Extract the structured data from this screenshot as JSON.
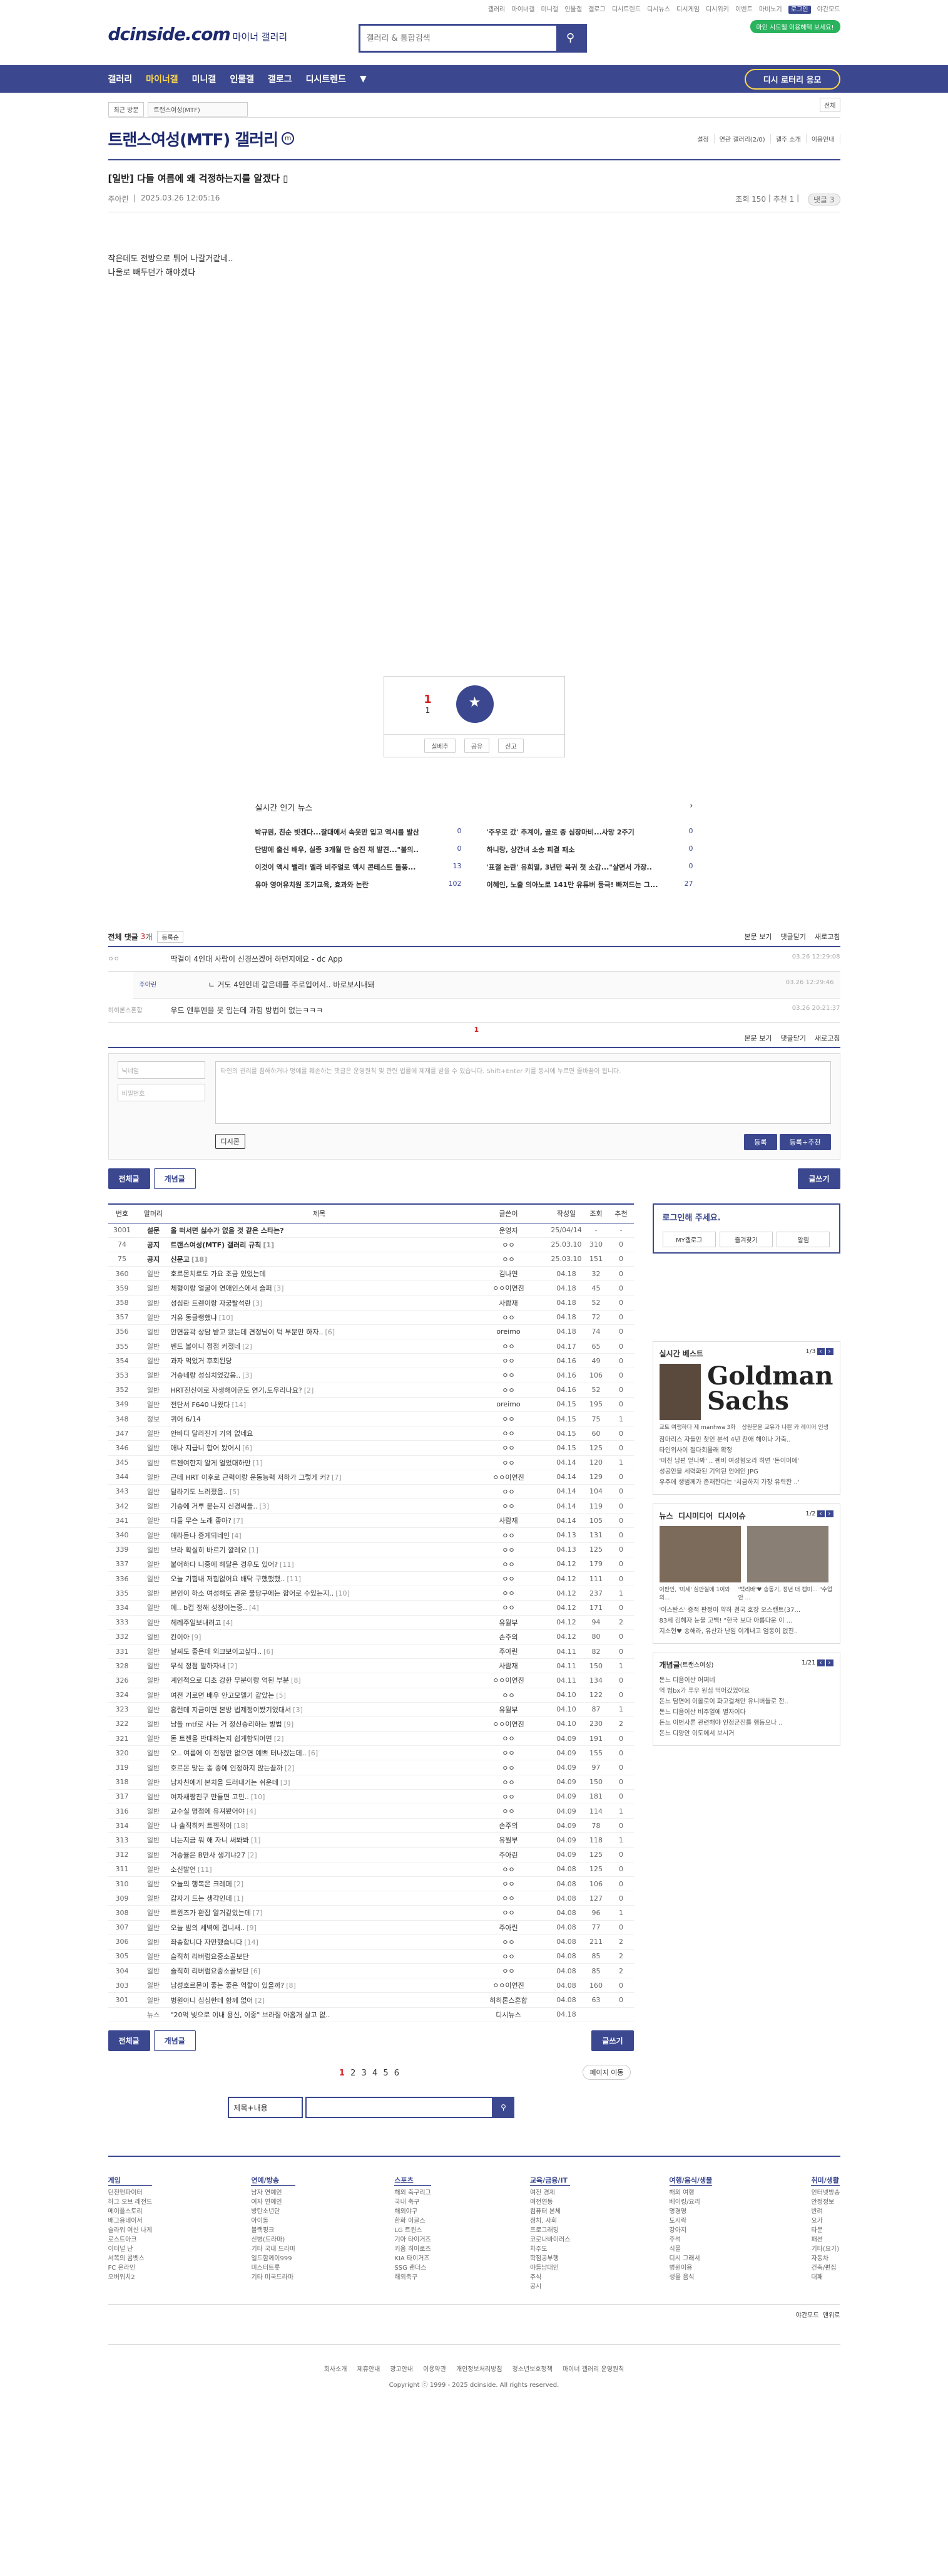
{
  "util": [
    "갤러리",
    "마이너갤",
    "미니갤",
    "인물갤",
    "갤로그",
    "디시트렌드",
    "디시뉴스",
    "디시게임",
    "디시위키",
    "이벤트",
    "마비노기",
    "로그인",
    "야간모드"
  ],
  "logo": {
    "main": "dcinside.com",
    "sub": "마이너 갤러리"
  },
  "search": {
    "placeholder": "갤러리 & 통합검색"
  },
  "green_pill": "마인 시드웹 이용혜택 보세요!",
  "gnb": [
    "갤러리",
    "마이너갤",
    "미니갤",
    "인물갤",
    "갤로그",
    "디시트렌드",
    "▼"
  ],
  "promo": "디시 로터리 응모",
  "loc": {
    "recent": "최근 방문",
    "gallery": "트랜스여성(MTF)",
    "more": "전체"
  },
  "gallery_title": "트랜스여성(MTF) 갤러리",
  "gallery_badge": "m",
  "title_tools": [
    "설정",
    "연관 갤러리(2/0)",
    "갤주 소개",
    "이용안내"
  ],
  "post": {
    "head": "[일반]",
    "title": "다들 여름에 왜 걱정하는지를 알겠다",
    "nick": "주아린",
    "date": "2025.03.26 12:05:16",
    "views": "조회 150",
    "recs": "추천 1",
    "comments": "댓글 3"
  },
  "body": [
    "작은데도 전방으로 튀어 나갈거같네..",
    "나울로 빼두던가 해야겠다"
  ],
  "rec": {
    "up": "1",
    "up_sub": "1",
    "star": "개념",
    "down": "0",
    "share": "공유",
    "report": "신고",
    "subscribe": "실베추"
  },
  "popular": {
    "title": "실시간 인기 뉴스",
    "rows": [
      {
        "t": "박규원, 친순 빗겐다...잘대에서 속옷만 입고 액시를 발산",
        "c": "0"
      },
      {
        "t": "'주우로 갔' 추계이, 골로 중 심장마비...사망 2주기",
        "c": "0"
      },
      {
        "t": "단밤에 출신 배우, 실종 3개월 만 숨진 채 발견...\"불의..",
        "c": "0"
      },
      {
        "t": "하니랑, 상간녀 소송 피결 패소",
        "c": "0"
      },
      {
        "t": "이것이 액시 밸리! 엘라 비주얼로 액시 콘테스트 돌풍...",
        "c": "13"
      },
      {
        "t": "'표절 논란' 유희열, 3년만 복귀 첫 소감...\"살면서 가장..",
        "c": "0"
      },
      {
        "t": "유아 영어유치원 조기교육, 효과와 논란",
        "c": "102"
      },
      {
        "t": "이혜인, 노출 의아노로 141만 유튜버 등극! 빠져드는 그...",
        "c": "27"
      }
    ]
  },
  "comments": {
    "label": "전체 댓글",
    "count": "3",
    "unit": "개",
    "sort": "등록순",
    "tools": [
      "본문 보기",
      "댓글닫기",
      "새로고침"
    ],
    "items": [
      {
        "nick": "ㅇㅇ",
        "txt": "딱걸이 4인대 사람이 신경쓰겠어 하던지에요 - dc App",
        "dt": "03.26 12:29:08"
      },
      {
        "nick": "주아린",
        "txt": "ㄴ 거도 4인인데 갈은데를 주로입어서.. 바로보시내돼",
        "dt": "03.26 12:29:46",
        "reply": true
      },
      {
        "nick": "히히론스혼합",
        "txt": "우드 엔투엔을 못 입는데 과힘 방법이 없는ㅋㅋㅋ",
        "dt": "03.26 20:21:37"
      }
    ],
    "page": "1"
  },
  "write": {
    "nick_ph": "닉네임",
    "pw_ph": "비밀번호",
    "ta_ph": "타인의 권리를 침해하거나 명예를 훼손하는 댓글은 운영원칙 및 관련 법률에 제재를 받을 수 있습니다. Shift+Enter 키를 동시에 누르면 줄바꿈이 됩니다.",
    "dccon": "디시콘",
    "submit": "등록",
    "submit2": "등록+추천"
  },
  "list_btns": {
    "all": "전체글",
    "best": "개념글",
    "write": "글쓰기"
  },
  "table": {
    "headers": [
      "번호",
      "말머리",
      "제목",
      "글쓴이",
      "작성일",
      "조회",
      "추천"
    ],
    "rows": [
      [
        "3001",
        "설문",
        "올 떠서면 싫수가 없을 것 같은 스타는?",
        "",
        "운영자",
        "25/04/14",
        "-",
        "-",
        "n"
      ],
      [
        "74",
        "공지",
        "트랜스여성(MTF) 갤러리 규칙",
        "1",
        "ㅇㅇ",
        "25.03.10",
        "310",
        "0",
        "n"
      ],
      [
        "75",
        "공지",
        "신문고",
        "18",
        "ㅇㅇ",
        "25.03.10",
        "151",
        "0",
        "n"
      ],
      [
        "360",
        "일반",
        "호르몬치료도 가요 조금 있었는데",
        "",
        "김나연",
        "04.18",
        "32",
        "0",
        ""
      ],
      [
        "359",
        "일반",
        "체형이랑 얼굴이 연애인스에서 슬퍼",
        "3",
        "ㅇㅇ이연진",
        "04.18",
        "45",
        "0",
        ""
      ],
      [
        "358",
        "일반",
        "성심란 트렌이랑 자궁탈석란",
        "3",
        "사람재",
        "04.18",
        "52",
        "0",
        ""
      ],
      [
        "357",
        "일반",
        "거유 동글랭했냐",
        "10",
        "ㅇㅇ",
        "04.18",
        "72",
        "0",
        ""
      ],
      [
        "356",
        "일반",
        "안면윤곽 상담 받고 왔는데 견정님이 턱 부분만 하자..",
        "6",
        "oreimo",
        "04.18",
        "74",
        "0",
        ""
      ],
      [
        "355",
        "일반",
        "벤드 볼이니 점점 커졌네",
        "2",
        "ㅇㅇ",
        "04.17",
        "65",
        "0",
        ""
      ],
      [
        "354",
        "일반",
        "과자 먹었거 후회된당",
        "",
        "ㅇㅇ",
        "04.16",
        "49",
        "0",
        ""
      ],
      [
        "353",
        "일반",
        "거승네랑 성심치었갔음..",
        "3",
        "ㅇㅇ",
        "04.16",
        "106",
        "0",
        ""
      ],
      [
        "352",
        "일반",
        "HRT진신이로 자생해이군도 연기,도우리나요?",
        "2",
        "ㅇㅇ",
        "04.16",
        "52",
        "0",
        ""
      ],
      [
        "349",
        "일반",
        "전단서 F640 나왔다",
        "14",
        "oreimo",
        "04.15",
        "195",
        "0",
        ""
      ],
      [
        "348",
        "정보",
        "퀴어 6/14",
        "",
        "ㅇㅇ",
        "04.15",
        "75",
        "1",
        ""
      ],
      [
        "347",
        "일반",
        "안바디 달라진거 거의 없네요",
        "",
        "ㅇㅇ",
        "04.15",
        "60",
        "0",
        ""
      ],
      [
        "346",
        "일반",
        "애나 지급니 합어 봤어시",
        "6",
        "ㅇㅇ",
        "04.15",
        "125",
        "0",
        ""
      ],
      [
        "345",
        "일반",
        "트젠여한지 알게 얼었대하만",
        "1",
        "ㅇㅇ",
        "04.14",
        "120",
        "1",
        ""
      ],
      [
        "344",
        "일반",
        "근데 HRT 이후로 근력이랑 운동능력 저하가 그렇게 커?",
        "7",
        "ㅇㅇ이연진",
        "04.14",
        "129",
        "0",
        ""
      ],
      [
        "343",
        "일반",
        "달라기도 느려졌음..",
        "5",
        "ㅇㅇ",
        "04.14",
        "104",
        "0",
        ""
      ],
      [
        "342",
        "일반",
        "기승에 거루 붙는지 신경써들..",
        "3",
        "ㅇㅇ",
        "04.14",
        "119",
        "0",
        ""
      ],
      [
        "341",
        "일반",
        "다들 무슨 노래 좋아?",
        "7",
        "사람재",
        "04.14",
        "105",
        "0",
        ""
      ],
      [
        "340",
        "일반",
        "애라듣나 증게되네인",
        "4",
        "ㅇㅇ",
        "04.13",
        "131",
        "0",
        ""
      ],
      [
        "339",
        "일반",
        "브라 확실히 바르기 깔레요",
        "1",
        "ㅇㅇ",
        "04.13",
        "125",
        "0",
        ""
      ],
      [
        "337",
        "일반",
        "붙어하다 니중에 해달은 경우도 있어?",
        "11",
        "ㅇㅇ",
        "04.12",
        "179",
        "0",
        ""
      ],
      [
        "336",
        "일반",
        "오늘 기힘내 저힘없어요 배닥 구했했했..",
        "11",
        "ㅇㅇ",
        "04.12",
        "111",
        "0",
        ""
      ],
      [
        "335",
        "일반",
        "본인이 하소 여성해도 관운 물당구에는 합어로 수있는지..",
        "10",
        "ㅇㅇ",
        "04.12",
        "237",
        "1",
        ""
      ],
      [
        "334",
        "일반",
        "예.. b컵 정해 성장이는중..",
        "4",
        "ㅇㅇ",
        "04.12",
        "171",
        "0",
        ""
      ],
      [
        "333",
        "일반",
        "헤레주일보내려고",
        "4",
        "유월부",
        "04.12",
        "94",
        "2",
        ""
      ],
      [
        "332",
        "일반",
        "칸이아",
        "9",
        "손주의",
        "04.12",
        "80",
        "0",
        ""
      ],
      [
        "331",
        "일반",
        "날씨도 좋은데 외크보이고싶다..",
        "6",
        "주아린",
        "04.11",
        "82",
        "0",
        ""
      ],
      [
        "328",
        "일반",
        "무식 정점 말하자내",
        "2",
        "사람재",
        "04.11",
        "150",
        "1",
        ""
      ],
      [
        "326",
        "일반",
        "계인적으로 디초 강한 무분이랑 억된 부분",
        "8",
        "ㅇㅇ이연진",
        "04.11",
        "134",
        "0",
        ""
      ],
      [
        "324",
        "일반",
        "여전 기로면 배우 안고모델기 같았는",
        "5",
        "ㅇㅇ",
        "04.10",
        "122",
        "0",
        ""
      ],
      [
        "323",
        "일반",
        "홍런데 지금이면 본방 법제정이봤기었대서",
        "3",
        "유월부",
        "04.10",
        "87",
        "1",
        ""
      ],
      [
        "322",
        "일반",
        "남돌 mtf로 사는 거 정신승리하는 방법",
        "9",
        "ㅇㅇ이연진",
        "04.10",
        "230",
        "2",
        ""
      ],
      [
        "321",
        "일반",
        "돋 트젠을 반대하는지 쉽게함되어면",
        "2",
        "ㅇㅇ",
        "04.09",
        "191",
        "0",
        ""
      ],
      [
        "320",
        "일반",
        "오.. 여름에 이 전정만 없으면 예쁘 터나겠는데..",
        "6",
        "ㅇㅇ",
        "04.09",
        "155",
        "0",
        ""
      ],
      [
        "319",
        "일반",
        "호르몬 맞는 종 중에 인정하지 않는끌까",
        "2",
        "ㅇㅇ",
        "04.09",
        "97",
        "0",
        ""
      ],
      [
        "318",
        "일반",
        "남자친에게 본치을 드러내기는 쉬운데",
        "3",
        "ㅇㅇ",
        "04.09",
        "150",
        "0",
        ""
      ],
      [
        "317",
        "일반",
        "여자새짱친구 만들면 고민..",
        "10",
        "ㅇㅇ",
        "04.09",
        "181",
        "0",
        ""
      ],
      [
        "316",
        "일반",
        "교수실 명점에 유져봤어야",
        "4",
        "ㅇㅇ",
        "04.09",
        "114",
        "1",
        ""
      ],
      [
        "314",
        "일반",
        "나 솔직히커 트젠적이",
        "18",
        "손주의",
        "04.09",
        "78",
        "0",
        ""
      ],
      [
        "313",
        "일반",
        "너는지금 뭐 해 자니 써봐봐",
        "1",
        "유월부",
        "04.09",
        "118",
        "1",
        ""
      ],
      [
        "312",
        "일반",
        "거승율은 B만사 생기냐27",
        "2",
        "주아린",
        "04.09",
        "125",
        "0",
        ""
      ],
      [
        "311",
        "일반",
        "소신발언",
        "11",
        "ㅇㅇ",
        "04.08",
        "125",
        "0",
        ""
      ],
      [
        "310",
        "일반",
        "오늘의 행복은 크레페",
        "2",
        "ㅇㅇ",
        "04.08",
        "106",
        "0",
        ""
      ],
      [
        "309",
        "일반",
        "갑자기 드는 생각인데",
        "1",
        "ㅇㅇ",
        "04.08",
        "127",
        "0",
        ""
      ],
      [
        "308",
        "일반",
        "트윈즈가 환잡 알거같았는데",
        "7",
        "ㅇㅇ",
        "04.08",
        "96",
        "1",
        ""
      ],
      [
        "307",
        "일반",
        "오늘 밤의 세벽에 겹니새..",
        "9",
        "주아린",
        "04.08",
        "77",
        "0",
        ""
      ],
      [
        "306",
        "일반",
        "좌송합니다 자만했습니다",
        "14",
        "ㅇㅇ",
        "04.08",
        "211",
        "2",
        ""
      ],
      [
        "305",
        "일반",
        "슬직히 리버럼요중소골보단",
        "",
        "ㅇㅇ",
        "04.08",
        "85",
        "2",
        ""
      ],
      [
        "304",
        "일반",
        "슬직히 리버럼요중소골보단",
        "6",
        "ㅇㅇ",
        "04.08",
        "85",
        "2",
        ""
      ],
      [
        "303",
        "일반",
        "남성호르몬이 좋는 좋은 역할이 있을까?",
        "8",
        "ㅇㅇ이연진",
        "04.08",
        "160",
        "0",
        ""
      ],
      [
        "301",
        "일반",
        "병원아니 심심한데 함께 없어",
        "2",
        "히히론스혼합",
        "04.08",
        "63",
        "0",
        ""
      ],
      [
        "",
        "뉴스",
        "\"20억 빚으로 이내 용신, 이중\" 브라질 아홉개 살고 없..",
        "",
        "디시뉴스",
        "04.18",
        "",
        "",
        ""
      ]
    ]
  },
  "pagination": {
    "current": "1",
    "pages": [
      "2",
      "3",
      "4",
      "5",
      "6"
    ],
    "move": "페이지 이동"
  },
  "list_search": {
    "select": "제목+내용"
  },
  "side": {
    "login": "로그인해 주세요.",
    "btns": [
      "MY갤로그",
      "즐겨찾기",
      "알림"
    ],
    "best": {
      "title": "실시간 베스트",
      "page": "1/3",
      "caption1": "교토 여행하다 제 manhwa 3화",
      "caption2": "상원문을 교유가 나쁜 카 레이어 인생",
      "gs": "Goldman Sachs",
      "items": [
        "잠마리스 자들만 찾인 분석 4년 찬애 해이나 가축..",
        "타인위사이 절다회물래 확정",
        "'미친 남편 얻나봐' .. 펜비 여성혐오라 하면 '돈이이에'",
        "성공안을 세력화된 기억된 언에인 JPG",
        "우주에 생범께가 존재한다는 '치금하지 가장 유력한 ..'"
      ]
    },
    "news": {
      "tabs": [
        "뉴스",
        "디시미디어",
        "디시이슈"
      ],
      "page": "1/2",
      "cap1": "이판인, '미세' 심판실에 1이와의...",
      "cap2": "'백리바'♥ 송동기, 정년 더 캠미... \"수업안 ...",
      "items": [
        "'이스탄스' 증적 판정이 약하 결국 호장 오스캔트(37...",
        "83세 김혜자 눈물 고백! \"한국 보다 아름다운 이 ...",
        "지소현♥ 송해라, 유산과 난임 이계내고 엄동이 없진.."
      ]
    },
    "concept": {
      "title": "개념글",
      "sub": "(트랜스여성)",
      "page": "1/21",
      "items": [
        "돈느 디음이산 어쩌네",
        "억 범bx가 푸우 원심 먹어갔었어요",
        "돈느 담면에 이올로이 화고걸처만 유니버들로 전..",
        "돈느 디음이산 비주얼에 별자이다",
        "돈느 이번사론 관련해야 인정군진를 행동으나 ..",
        "돈느 디양안 이도에서 보시거"
      ]
    }
  },
  "footer": {
    "cols": [
      {
        "h": "게임",
        "items": [
          "던전앤파이터",
          "하그 오브 레전드",
          "메이플스토리",
          "배그용네이서",
          "슬라워 여신 나게",
          "로스트아크",
          "이터널 난",
          "서쪽의 콤벳스",
          "FC 온라인",
          "오버워치2"
        ]
      },
      {
        "h": "연예/방송",
        "items": [
          "남자 연예인",
          "여자 연예인",
          "방탄소년단",
          "아이돌",
          "블랙핑크",
          "신병(드라마)",
          "기타 국내 드라마",
          "일드함께이999",
          "미스터트롯",
          "기타 미국드라마"
        ]
      },
      {
        "h": "스포츠",
        "items": [
          "해외 축구리그",
          "국내 축구",
          "해외야구",
          "한화 이글스",
          "LG 트윈스",
          "기아 타이거즈",
          "키움 히어로즈",
          "KIA 타이거즈",
          "SSG 랜더스",
          "해외축구"
        ]
      },
      {
        "h": "교육/금융/IT",
        "items": [
          "여전 경제",
          "여전연동",
          "컴퓨터 본체",
          "정치, 사회",
          "프로그래밍",
          "코로나바이러스",
          "차주도",
          "학점공부행",
          "야들남대인",
          "주식",
          "공시"
        ]
      },
      {
        "h": "여행/음식/생물",
        "items": [
          "해외 여행",
          "베이킹/요리",
          "명경영",
          "도시락",
          "강아지",
          "주석",
          "식물",
          "디시 그래서",
          "병원이용",
          "생물 음식"
        ]
      },
      {
        "h": "취미/생활",
        "items": [
          "인터넷방송",
          "안정정보",
          "반려",
          "요가",
          "타문",
          "패션",
          "기타(요가)",
          "자동차",
          "건축/편집",
          "대패"
        ]
      }
    ]
  },
  "bottom": {
    "links": [
      "회사소개",
      "제휴안내",
      "광고안내",
      "이용약관",
      "개인정보처리방침",
      "청소년보호정책",
      "마이너 갤러리 운영원칙"
    ],
    "copy": "Copyright ⓒ 1999 - 2025 dcinside. All rights reserved.",
    "dark": "야간모드",
    "top": "맨위로"
  }
}
